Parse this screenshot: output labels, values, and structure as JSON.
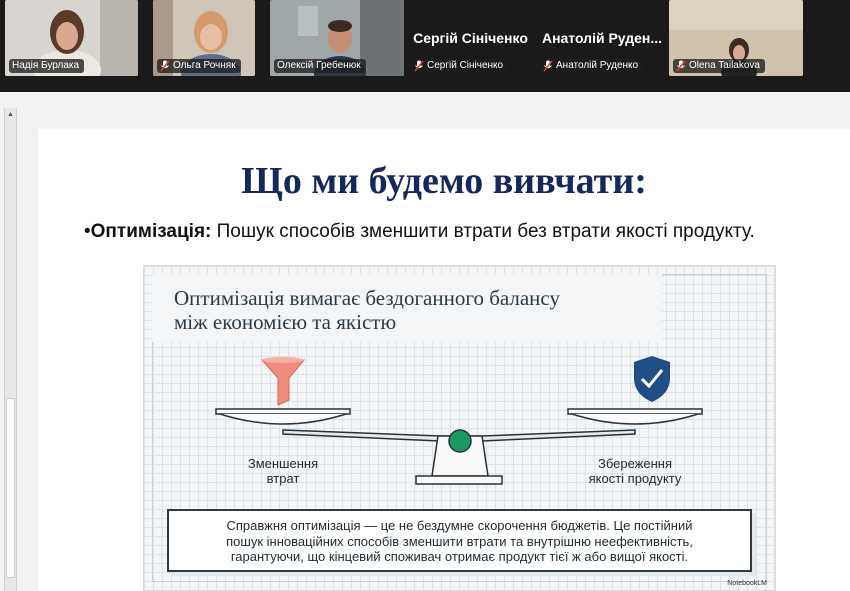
{
  "participants": [
    {
      "name": "Надія Бурлака",
      "muted": false,
      "video": true
    },
    {
      "name": "Ольга Рочняк",
      "muted": true,
      "video": true
    },
    {
      "name": "Олексій Гребенюк",
      "muted": false,
      "video": true,
      "active_speaker": true
    },
    {
      "display_name": "Сергій Сініченко",
      "name": "Сергій Сініченко",
      "muted": true,
      "video": false
    },
    {
      "display_name": "Анатолій Руден...",
      "name": "Анатолій Руденко",
      "muted": true,
      "video": false
    },
    {
      "name": "Olena Tailakova",
      "muted": true,
      "video": true
    }
  ],
  "slide": {
    "title": "Що ми будемо вивчати:",
    "bullet_term": "Оптимізація:",
    "bullet_text": " Пошук способів зменшити втрати без втрати якості продукту."
  },
  "infographic": {
    "title_line1": "Оптимізація вимагає бездоганного балансу",
    "title_line2": "між економією та якістю",
    "left_caption_line1": "Зменшення",
    "left_caption_line2": "втрат",
    "right_caption_line1": "Збереження",
    "right_caption_line2": "якості продукту",
    "note_line1": "Справжня оптимізація — це не бездумне скорочення бюджетів. Це постійний",
    "note_line2": "пошук інноваційних способів зменшити втрати та внутрішню неефективність,",
    "note_line3": "гарантуючи, що кінцевий споживач отримає продукт тієї ж або вищої якості.",
    "watermark": "NotebookLM"
  },
  "colors": {
    "title": "#16285a",
    "funnel": "#f08c7c",
    "shield": "#1f4e86",
    "pivot": "#1a9a60",
    "active_border": "#22c55e",
    "muted_mic": "#e53935"
  }
}
